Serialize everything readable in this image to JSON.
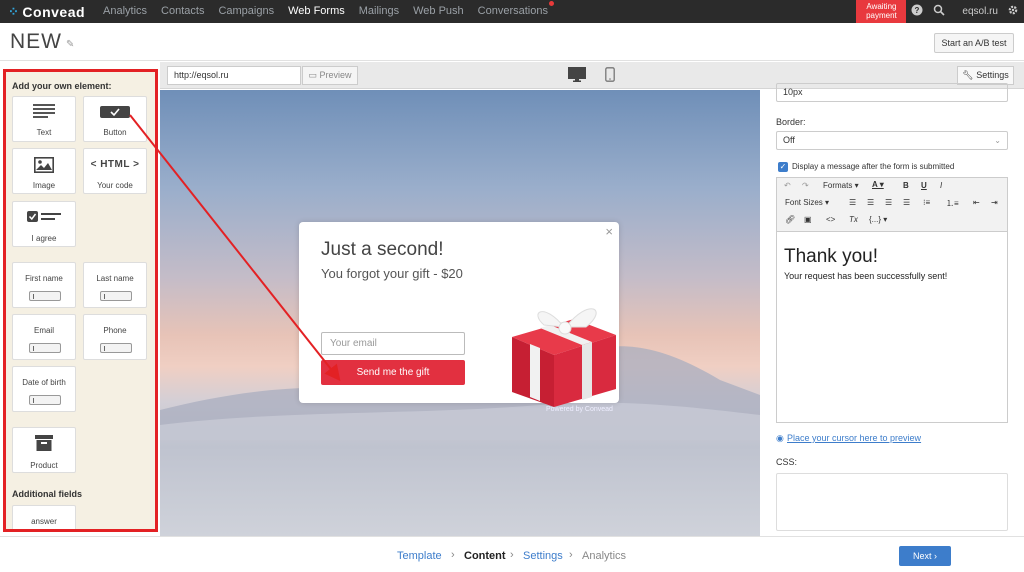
{
  "nav": {
    "logo": "Convead",
    "items": [
      "Analytics",
      "Contacts",
      "Campaigns",
      "Web Forms",
      "Mailings",
      "Web Push",
      "Conversations"
    ],
    "awaiting_line1": "Awaiting",
    "awaiting_line2": "payment",
    "account": "eqsol.ru"
  },
  "header": {
    "title": "NEW",
    "ab_button": "Start an A/B test"
  },
  "left_panel": {
    "heading": "Add your own element:",
    "tiles": {
      "text": "Text",
      "button": "Button",
      "image": "Image",
      "code": "Your code",
      "code_icon": "< HTML >",
      "agree": "I agree",
      "first_name": "First name",
      "last_name": "Last name",
      "email": "Email",
      "phone": "Phone",
      "dob": "Date of birth",
      "product": "Product",
      "answer": "answer"
    },
    "additional": "Additional fields"
  },
  "toolbar": {
    "url": "http://eqsol.ru",
    "preview": "Preview",
    "settings": "Settings"
  },
  "popup": {
    "title": "Just a second!",
    "subtitle": "You forgot your gift - $20",
    "email_placeholder": "Your email",
    "button": "Send me the gift",
    "powered": "Powered by Convead",
    "close": "×"
  },
  "right_panel": {
    "padding_value": "10px",
    "border_label": "Border:",
    "border_value": "Off",
    "checkbox_label": "Display a message after the form is submitted",
    "formats": "Formats",
    "font_sizes": "Font Sizes",
    "msg_title": "Thank you!",
    "msg_body": "Your request has been successfully sent!",
    "place_link": "Place your cursor here to preview",
    "css_label": "CSS:"
  },
  "footer": {
    "steps": [
      "Template",
      "Content",
      "Settings",
      "Analytics"
    ],
    "next": "Next"
  },
  "colors": {
    "accent": "#3d7dcb",
    "alert": "#e32124",
    "cta": "#e23040"
  }
}
